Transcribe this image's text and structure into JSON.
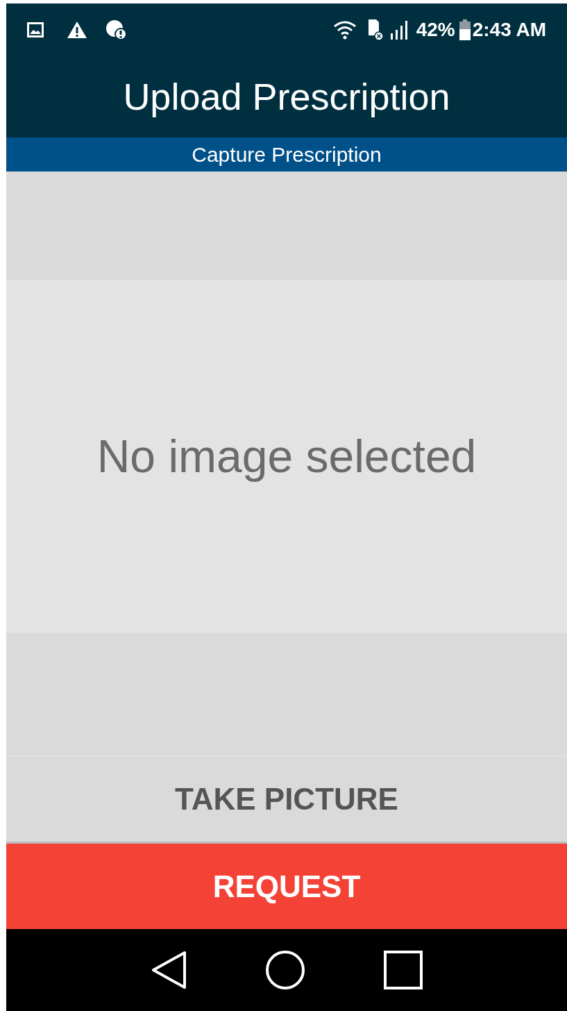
{
  "status_bar": {
    "battery": "42%",
    "time": "2:43 AM"
  },
  "app_bar": {
    "title": "Upload Prescription"
  },
  "subheader": {
    "title": "Capture Prescription"
  },
  "preview": {
    "message": "No image selected"
  },
  "buttons": [
    {
      "label": "TAKE PICTURE",
      "kind": "secondary"
    },
    {
      "label": "REQUEST",
      "kind": "primary"
    }
  ]
}
